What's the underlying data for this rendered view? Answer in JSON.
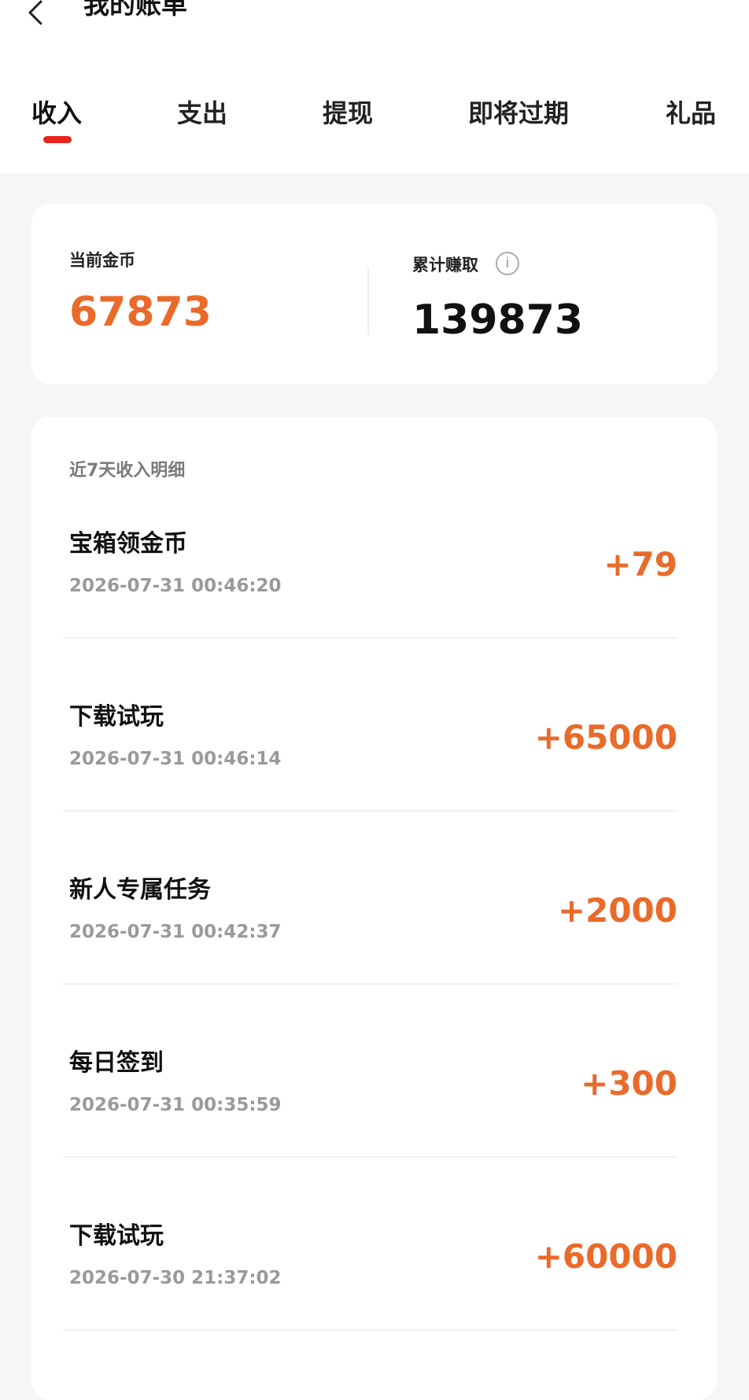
{
  "header": {
    "title": "我的账单"
  },
  "tabs": [
    "收入",
    "支出",
    "提现",
    "即将过期",
    "礼品"
  ],
  "summary": {
    "current_label": "当前金币",
    "current_value": "67873",
    "total_label": "累计赚取",
    "total_value": "139873"
  },
  "details": {
    "section_title": "近7天收入明细",
    "rows": [
      {
        "name": "宝箱领金币",
        "time": "2026-07-31  00:46:20",
        "amount": "+79"
      },
      {
        "name": "下载试玩",
        "time": "2026-07-31  00:46:14",
        "amount": "+65000"
      },
      {
        "name": "新人专属任务",
        "time": "2026-07-31  00:42:37",
        "amount": "+2000"
      },
      {
        "name": "每日签到",
        "time": "2026-07-31  00:35:59",
        "amount": "+300"
      },
      {
        "name": "下载试玩",
        "time": "2026-07-30  21:37:02",
        "amount": "+60000"
      }
    ]
  },
  "colors": {
    "accent": "#ea6a2a",
    "tab_indicator": "#e8231e"
  },
  "icons": {
    "back": "chevron-left-icon",
    "info": "info-icon"
  }
}
